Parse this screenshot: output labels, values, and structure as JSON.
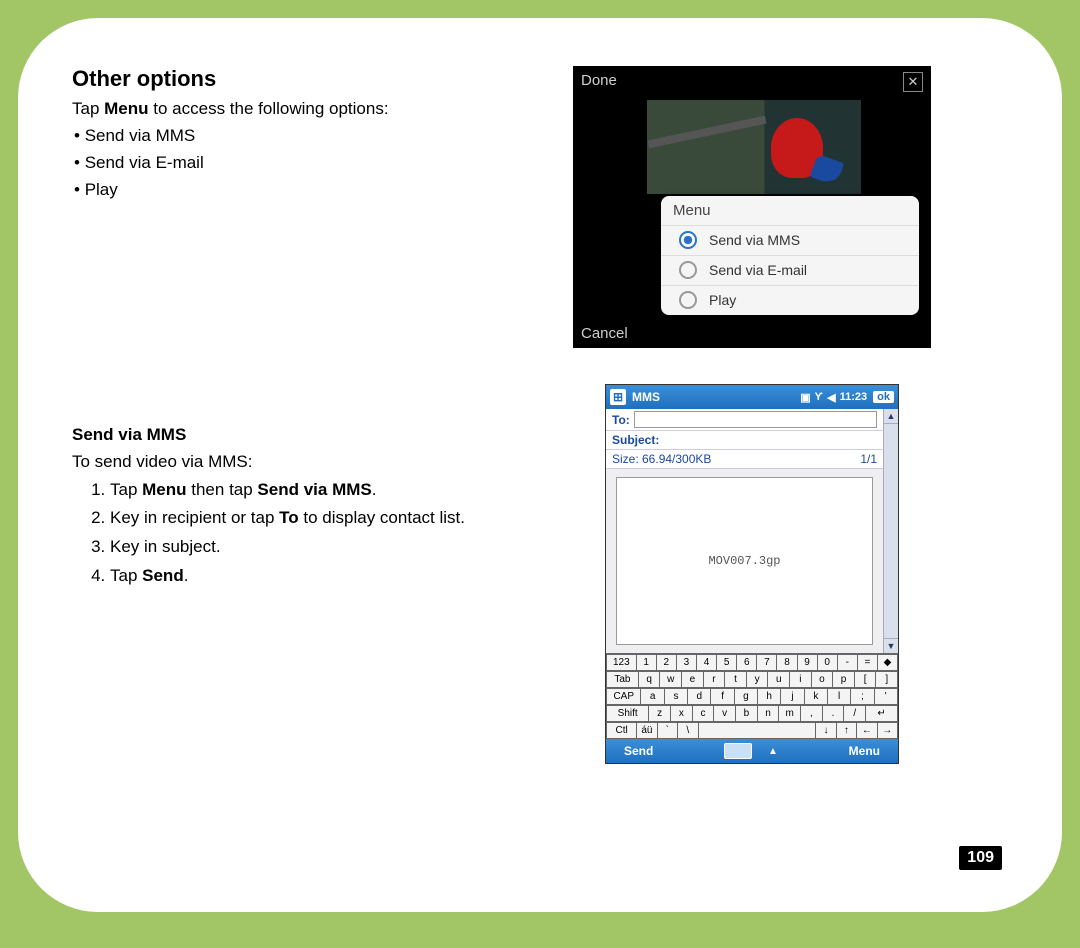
{
  "page_number": "109",
  "section1": {
    "heading": "Other options",
    "intro_pre": "Tap ",
    "intro_bold": "Menu",
    "intro_post": " to access the following options:",
    "bullets": [
      "Send via MMS",
      "Send via E-mail",
      "Play"
    ]
  },
  "section2": {
    "heading": "Send via MMS",
    "intro": "To send video via MMS:",
    "steps": [
      {
        "parts": [
          "Tap ",
          "Menu",
          " then tap ",
          "Send via MMS",
          "."
        ]
      },
      {
        "parts": [
          "Key in recipient or tap ",
          "To",
          " to display contact list."
        ]
      },
      {
        "parts": [
          "Key in subject."
        ]
      },
      {
        "parts": [
          "Tap ",
          "Send",
          "."
        ]
      }
    ]
  },
  "shot1": {
    "done": "Done",
    "menu_label": "Menu",
    "items": [
      "Send via MMS",
      "Send via E-mail",
      "Play"
    ],
    "cancel": "Cancel"
  },
  "shot2": {
    "app": "MMS",
    "time": "11:23",
    "ok": "ok",
    "to_label": "To:",
    "subject_label": "Subject:",
    "size_text": "Size: 66.94/300KB",
    "slide": "1/1",
    "attachment": "MOV007.3gp",
    "soft_left": "Send",
    "soft_right": "Menu",
    "kb": {
      "r1": [
        "123",
        "1",
        "2",
        "3",
        "4",
        "5",
        "6",
        "7",
        "8",
        "9",
        "0",
        "-",
        "=",
        "◆"
      ],
      "r2": [
        "Tab",
        "q",
        "w",
        "e",
        "r",
        "t",
        "y",
        "u",
        "i",
        "o",
        "p",
        "[",
        "]"
      ],
      "r3": [
        "CAP",
        "a",
        "s",
        "d",
        "f",
        "g",
        "h",
        "j",
        "k",
        "l",
        ";",
        "'"
      ],
      "r4": [
        "Shift",
        "z",
        "x",
        "c",
        "v",
        "b",
        "n",
        "m",
        ",",
        ".",
        "/",
        "↵"
      ],
      "r5": [
        "Ctl",
        "áü",
        "`",
        "\\",
        "",
        "↓",
        "↑",
        "←",
        "→"
      ]
    }
  }
}
